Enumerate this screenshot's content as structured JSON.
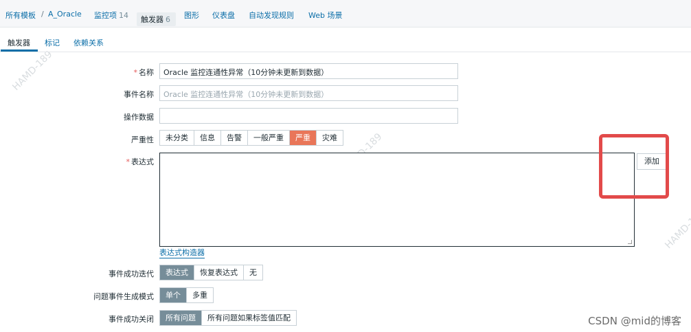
{
  "breadcrumb": {
    "all_templates": "所有模板",
    "separator": "/",
    "template": "A_Oracle",
    "items": {
      "label": "监控项",
      "count": "14"
    },
    "triggers": {
      "label": "触发器",
      "count": "6"
    },
    "graphs": "图形",
    "dashboards": "仪表盘",
    "discovery": "自动发现规则",
    "web": "Web 场景"
  },
  "subtabs": {
    "trigger": "触发器",
    "tags": "标记",
    "dependencies": "依赖关系"
  },
  "form": {
    "name": {
      "label": "名称",
      "value": "Oracle 监控连通性异常（10分钟未更新到数据）"
    },
    "event_name": {
      "label": "事件名称",
      "placeholder": "Oracle 监控连通性异常（10分钟未更新到数据）"
    },
    "operational_data": {
      "label": "操作数据",
      "value": ""
    },
    "severity": {
      "label": "严重性",
      "options": [
        "未分类",
        "信息",
        "告警",
        "一般严重",
        "严重",
        "灾难"
      ],
      "selected": "严重"
    },
    "expression": {
      "label": "表达式",
      "value": "",
      "add_button": "添加",
      "constructor_link": "表达式构造器"
    },
    "ok_event_generation": {
      "label": "事件成功迭代",
      "options": [
        "表达式",
        "恢复表达式",
        "无"
      ],
      "selected": "表达式"
    },
    "problem_event_mode": {
      "label": "问题事件生成模式",
      "options": [
        "单个",
        "多重"
      ],
      "selected": "单个"
    },
    "ok_event_closes": {
      "label": "事件成功关闭",
      "options": [
        "所有问题",
        "所有问题如果标签值匹配"
      ],
      "selected": "所有问题"
    }
  },
  "watermark": "CSDN @mid的博客",
  "faint_watermark": "HAMD-189",
  "colors": {
    "link": "#0b6ea8",
    "selected_segment": "#768d99",
    "severity_high": "#e97659",
    "annotation": "#e24a4a"
  }
}
